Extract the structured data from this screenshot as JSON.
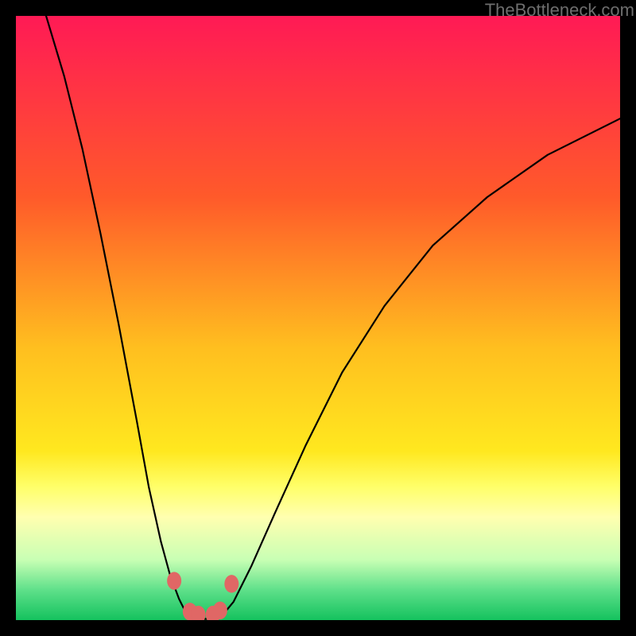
{
  "watermark": "TheBottleneck.com",
  "chart_data": {
    "type": "line",
    "title": "",
    "xlabel": "",
    "ylabel": "",
    "xlim": [
      0,
      100
    ],
    "ylim": [
      0,
      100
    ],
    "background_gradient": {
      "stops": [
        {
          "offset": 0,
          "color": "#ff1a55"
        },
        {
          "offset": 30,
          "color": "#ff5a2a"
        },
        {
          "offset": 55,
          "color": "#ffbf1f"
        },
        {
          "offset": 72,
          "color": "#ffe81f"
        },
        {
          "offset": 78,
          "color": "#ffff6a"
        },
        {
          "offset": 83,
          "color": "#ffffb0"
        },
        {
          "offset": 90,
          "color": "#c8ffb4"
        },
        {
          "offset": 95,
          "color": "#5fe08a"
        },
        {
          "offset": 100,
          "color": "#14c25e"
        }
      ]
    },
    "series": [
      {
        "name": "left-branch",
        "x": [
          5,
          8,
          11,
          14,
          17,
          20,
          22,
          24,
          25.5,
          27,
          28,
          29
        ],
        "y": [
          100,
          90,
          78,
          64,
          49,
          33,
          22,
          13,
          7.5,
          3.5,
          1.5,
          0.5
        ]
      },
      {
        "name": "valley-floor",
        "x": [
          29,
          30,
          31,
          32,
          33,
          34
        ],
        "y": [
          0.5,
          0.2,
          0.2,
          0.2,
          0.3,
          0.6
        ]
      },
      {
        "name": "right-branch",
        "x": [
          34,
          36,
          39,
          43,
          48,
          54,
          61,
          69,
          78,
          88,
          100
        ],
        "y": [
          0.6,
          3,
          9,
          18,
          29,
          41,
          52,
          62,
          70,
          77,
          83
        ]
      }
    ],
    "markers": {
      "name": "valley-markers",
      "color": "#e06765",
      "points": [
        {
          "x": 26.2,
          "y": 6.5
        },
        {
          "x": 28.8,
          "y": 1.4
        },
        {
          "x": 30.2,
          "y": 0.9
        },
        {
          "x": 32.6,
          "y": 0.9
        },
        {
          "x": 33.8,
          "y": 1.6
        },
        {
          "x": 35.7,
          "y": 6.0
        }
      ],
      "radius": 9
    }
  }
}
